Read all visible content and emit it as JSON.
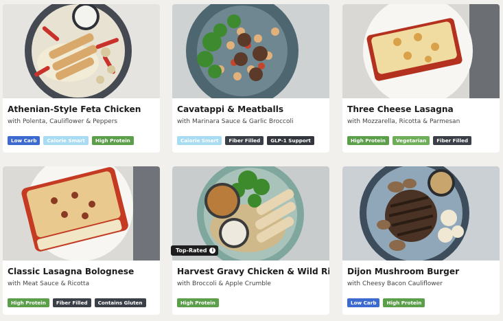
{
  "cards": [
    {
      "title": "Athenian-Style Feta Chicken",
      "subtitle": "with Polenta, Cauliflower & Peppers",
      "tags": [
        "Low Carb",
        "Calorie Smart",
        "High Protein"
      ]
    },
    {
      "title": "Cavatappi & Meatballs",
      "subtitle": "with Marinara Sauce & Garlic Broccoli",
      "tags": [
        "Calorie Smart",
        "Fiber Filled",
        "GLP-1 Support"
      ]
    },
    {
      "title": "Three Cheese Lasagna",
      "subtitle": "with Mozzarella, Ricotta & Parmesan",
      "tags": [
        "High Protein",
        "Vegetarian",
        "Fiber Filled"
      ]
    },
    {
      "title": "Classic Lasagna Bolognese",
      "subtitle": "with Meat Sauce & Ricotta",
      "tags": [
        "High Protein",
        "Fiber Filled",
        "Contains Gluten"
      ]
    },
    {
      "title": "Harvest Gravy Chicken & Wild Rice",
      "subtitle": "with Broccoli & Apple Crumble",
      "tags": [
        "High Protein"
      ],
      "badge": "Top-Rated"
    },
    {
      "title": "Dijon Mushroom Burger",
      "subtitle": "with Cheesy Bacon Cauliflower",
      "tags": [
        "Low Carb",
        "High Protein"
      ]
    }
  ],
  "icons": {
    "badge_info": "info-circle-icon"
  },
  "colors": {
    "low_carb": "#3d6ad0",
    "calorie_smart": "#a8dcf2",
    "high_protein": "#5c9f4a",
    "fiber_filled": "#3b3f47",
    "glp1_support": "#33373d",
    "vegetarian": "#6fae58",
    "contains_gluten": "#3b3f47"
  }
}
